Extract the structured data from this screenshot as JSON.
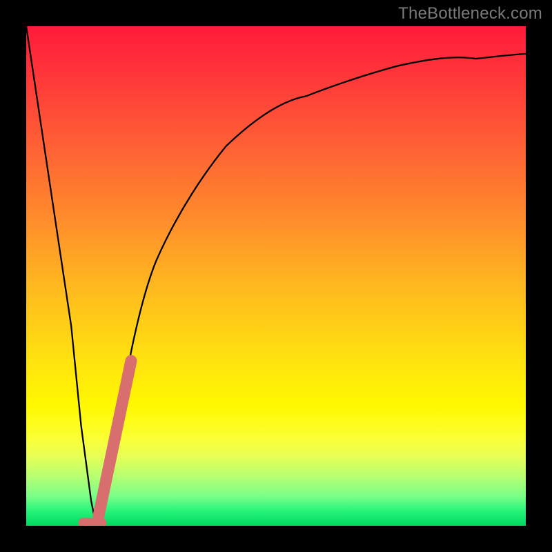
{
  "attribution": "TheBottleneck.com",
  "colors": {
    "frame": "#000000",
    "curve": "#000000",
    "marker": "#d86e6e",
    "gradient_top": "#ff1a3a",
    "gradient_bottom": "#00d860"
  },
  "chart_data": {
    "type": "line",
    "title": "",
    "xlabel": "",
    "ylabel": "",
    "xlim": [
      0,
      100
    ],
    "ylim": [
      0,
      100
    ],
    "series": [
      {
        "name": "bottleneck-curve",
        "x": [
          0,
          3,
          6,
          9,
          11,
          13,
          14,
          15,
          17,
          20,
          23,
          26,
          30,
          35,
          40,
          46,
          53,
          60,
          68,
          76,
          84,
          92,
          100
        ],
        "y": [
          100,
          80,
          60,
          40,
          20,
          5,
          0,
          3,
          12,
          28,
          42,
          53,
          62,
          70,
          76,
          81,
          85,
          88,
          90,
          91.5,
          92.5,
          93,
          93.5
        ]
      }
    ],
    "markers": [
      {
        "name": "highlight-segment",
        "shape": "pill",
        "color": "#d86e6e",
        "endpoints": {
          "x1": 14.5,
          "y1": 2,
          "x2": 21.0,
          "y2": 33
        }
      },
      {
        "name": "highlight-base",
        "shape": "pill",
        "color": "#d86e6e",
        "endpoints": {
          "x1": 11.5,
          "y1": 0.5,
          "x2": 15.0,
          "y2": 0.5
        }
      }
    ]
  }
}
